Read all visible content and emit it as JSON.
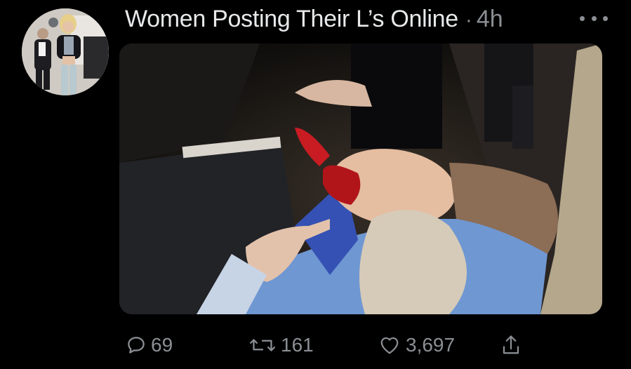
{
  "tweet": {
    "display_name": "Women Posting Their L’s Online",
    "separator": "·",
    "timestamp": "4h",
    "avatar_icon": "profile-photo",
    "more_icon": "more-dots-icon",
    "media_description_icon": "photo-media"
  },
  "actions": {
    "reply": {
      "icon": "reply-icon",
      "count": "69"
    },
    "retweet": {
      "icon": "retweet-icon",
      "count": "161"
    },
    "like": {
      "icon": "heart-icon",
      "count": "3,697"
    },
    "share": {
      "icon": "share-icon"
    }
  },
  "colors": {
    "background": "#000000",
    "primary_text": "#e7e9ea",
    "secondary_text": "#8b8f94"
  }
}
